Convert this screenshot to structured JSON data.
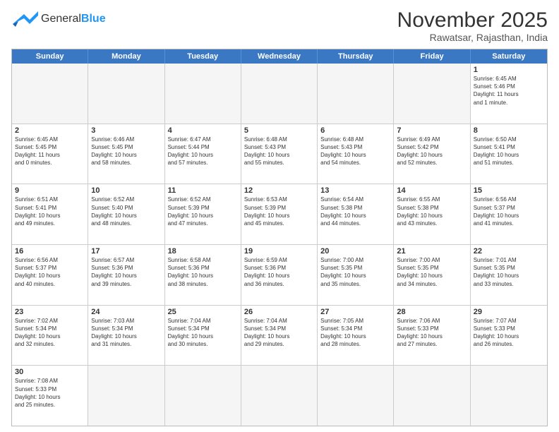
{
  "header": {
    "logo_general": "General",
    "logo_blue": "Blue",
    "title": "November 2025",
    "subtitle": "Rawatsar, Rajasthan, India"
  },
  "days_of_week": [
    "Sunday",
    "Monday",
    "Tuesday",
    "Wednesday",
    "Thursday",
    "Friday",
    "Saturday"
  ],
  "weeks": [
    [
      {
        "day": "",
        "info": ""
      },
      {
        "day": "",
        "info": ""
      },
      {
        "day": "",
        "info": ""
      },
      {
        "day": "",
        "info": ""
      },
      {
        "day": "",
        "info": ""
      },
      {
        "day": "",
        "info": ""
      },
      {
        "day": "1",
        "info": "Sunrise: 6:45 AM\nSunset: 5:46 PM\nDaylight: 11 hours\nand 1 minute."
      }
    ],
    [
      {
        "day": "2",
        "info": "Sunrise: 6:45 AM\nSunset: 5:45 PM\nDaylight: 11 hours\nand 0 minutes."
      },
      {
        "day": "3",
        "info": "Sunrise: 6:46 AM\nSunset: 5:45 PM\nDaylight: 10 hours\nand 58 minutes."
      },
      {
        "day": "4",
        "info": "Sunrise: 6:47 AM\nSunset: 5:44 PM\nDaylight: 10 hours\nand 57 minutes."
      },
      {
        "day": "5",
        "info": "Sunrise: 6:48 AM\nSunset: 5:43 PM\nDaylight: 10 hours\nand 55 minutes."
      },
      {
        "day": "6",
        "info": "Sunrise: 6:48 AM\nSunset: 5:43 PM\nDaylight: 10 hours\nand 54 minutes."
      },
      {
        "day": "7",
        "info": "Sunrise: 6:49 AM\nSunset: 5:42 PM\nDaylight: 10 hours\nand 52 minutes."
      },
      {
        "day": "8",
        "info": "Sunrise: 6:50 AM\nSunset: 5:41 PM\nDaylight: 10 hours\nand 51 minutes."
      }
    ],
    [
      {
        "day": "9",
        "info": "Sunrise: 6:51 AM\nSunset: 5:41 PM\nDaylight: 10 hours\nand 49 minutes."
      },
      {
        "day": "10",
        "info": "Sunrise: 6:52 AM\nSunset: 5:40 PM\nDaylight: 10 hours\nand 48 minutes."
      },
      {
        "day": "11",
        "info": "Sunrise: 6:52 AM\nSunset: 5:39 PM\nDaylight: 10 hours\nand 47 minutes."
      },
      {
        "day": "12",
        "info": "Sunrise: 6:53 AM\nSunset: 5:39 PM\nDaylight: 10 hours\nand 45 minutes."
      },
      {
        "day": "13",
        "info": "Sunrise: 6:54 AM\nSunset: 5:38 PM\nDaylight: 10 hours\nand 44 minutes."
      },
      {
        "day": "14",
        "info": "Sunrise: 6:55 AM\nSunset: 5:38 PM\nDaylight: 10 hours\nand 43 minutes."
      },
      {
        "day": "15",
        "info": "Sunrise: 6:56 AM\nSunset: 5:37 PM\nDaylight: 10 hours\nand 41 minutes."
      }
    ],
    [
      {
        "day": "16",
        "info": "Sunrise: 6:56 AM\nSunset: 5:37 PM\nDaylight: 10 hours\nand 40 minutes."
      },
      {
        "day": "17",
        "info": "Sunrise: 6:57 AM\nSunset: 5:36 PM\nDaylight: 10 hours\nand 39 minutes."
      },
      {
        "day": "18",
        "info": "Sunrise: 6:58 AM\nSunset: 5:36 PM\nDaylight: 10 hours\nand 38 minutes."
      },
      {
        "day": "19",
        "info": "Sunrise: 6:59 AM\nSunset: 5:36 PM\nDaylight: 10 hours\nand 36 minutes."
      },
      {
        "day": "20",
        "info": "Sunrise: 7:00 AM\nSunset: 5:35 PM\nDaylight: 10 hours\nand 35 minutes."
      },
      {
        "day": "21",
        "info": "Sunrise: 7:00 AM\nSunset: 5:35 PM\nDaylight: 10 hours\nand 34 minutes."
      },
      {
        "day": "22",
        "info": "Sunrise: 7:01 AM\nSunset: 5:35 PM\nDaylight: 10 hours\nand 33 minutes."
      }
    ],
    [
      {
        "day": "23",
        "info": "Sunrise: 7:02 AM\nSunset: 5:34 PM\nDaylight: 10 hours\nand 32 minutes."
      },
      {
        "day": "24",
        "info": "Sunrise: 7:03 AM\nSunset: 5:34 PM\nDaylight: 10 hours\nand 31 minutes."
      },
      {
        "day": "25",
        "info": "Sunrise: 7:04 AM\nSunset: 5:34 PM\nDaylight: 10 hours\nand 30 minutes."
      },
      {
        "day": "26",
        "info": "Sunrise: 7:04 AM\nSunset: 5:34 PM\nDaylight: 10 hours\nand 29 minutes."
      },
      {
        "day": "27",
        "info": "Sunrise: 7:05 AM\nSunset: 5:34 PM\nDaylight: 10 hours\nand 28 minutes."
      },
      {
        "day": "28",
        "info": "Sunrise: 7:06 AM\nSunset: 5:33 PM\nDaylight: 10 hours\nand 27 minutes."
      },
      {
        "day": "29",
        "info": "Sunrise: 7:07 AM\nSunset: 5:33 PM\nDaylight: 10 hours\nand 26 minutes."
      }
    ],
    [
      {
        "day": "30",
        "info": "Sunrise: 7:08 AM\nSunset: 5:33 PM\nDaylight: 10 hours\nand 25 minutes."
      },
      {
        "day": "",
        "info": ""
      },
      {
        "day": "",
        "info": ""
      },
      {
        "day": "",
        "info": ""
      },
      {
        "day": "",
        "info": ""
      },
      {
        "day": "",
        "info": ""
      },
      {
        "day": "",
        "info": ""
      }
    ]
  ]
}
